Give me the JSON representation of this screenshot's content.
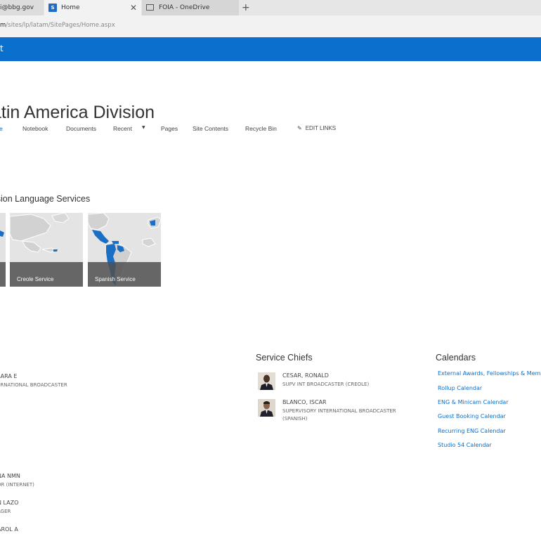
{
  "browser": {
    "tabs": [
      {
        "title": "i@bbg.gov",
        "active": false
      },
      {
        "title": "Home",
        "active": true
      },
      {
        "title": "FOIA - OneDrive",
        "active": false
      }
    ],
    "new_tab": "+",
    "close": "✕",
    "url_prefix": "m",
    "url_rest": "/sites/lp/latam/SitePages/Home.aspx"
  },
  "suite": {
    "letter": "t",
    "color": "#0a6fcd"
  },
  "site": {
    "title": "atin America Division",
    "nav": {
      "home": "me",
      "notebook": "Notebook",
      "documents": "Documents",
      "recent": "Recent",
      "pages": "Pages",
      "site_contents": "Site Contents",
      "recycle_bin": "Recycle Bin",
      "edit_links": "EDIT LINKS"
    }
  },
  "language_services": {
    "title": "ision Language Services",
    "tiles": [
      {
        "label": ""
      },
      {
        "label": "Creole Service"
      },
      {
        "label": "Spanish Service"
      }
    ]
  },
  "left_people": [
    {
      "name": "LARA E",
      "title": "ERNATIONAL BROADCASTER"
    },
    {
      "name": "NA NMN",
      "title": "OR (INTERNET)"
    },
    {
      "name": "N LAZO",
      "title": "AGER"
    },
    {
      "name": "AROL A",
      "title": ""
    }
  ],
  "service_chiefs": {
    "title": "Service Chiefs",
    "people": [
      {
        "name": "CESAR, RONALD",
        "title": "SUPV INT BROADCASTER (CREOLE)"
      },
      {
        "name": "BLANCO, ISCAR",
        "title": "SUPERVISORY INTERNATIONAL BROADCASTER (SPANISH)"
      }
    ]
  },
  "calendars": {
    "title": "Calendars",
    "links": [
      "External Awards, Fellowships & Meml",
      "Rollup Calendar",
      "ENG & Minicam Calendar",
      "Guest Booking Calendar",
      "Recurring ENG Calendar",
      "Studio 54 Calendar"
    ]
  }
}
